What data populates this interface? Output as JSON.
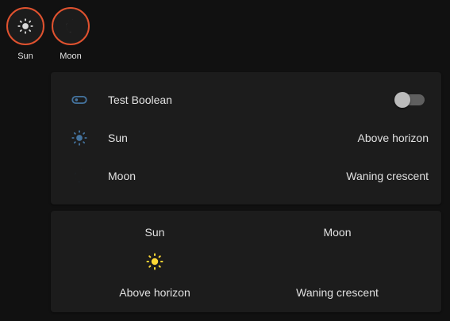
{
  "badges": [
    {
      "label": "Sun",
      "icon": "sun-icon"
    },
    {
      "label": "Moon",
      "icon": "moon-icon"
    }
  ],
  "entities": [
    {
      "name": "Test Boolean",
      "icon": "toggle-icon",
      "state": "off"
    },
    {
      "name": "Sun",
      "icon": "sun-icon",
      "state": "Above horizon"
    },
    {
      "name": "Moon",
      "icon": "moon-icon",
      "state": "Waning crescent"
    }
  ],
  "glance": [
    {
      "name": "Sun",
      "icon": "sun-icon",
      "state": "Above horizon"
    },
    {
      "name": "Moon",
      "icon": "moon-icon",
      "state": "Waning crescent"
    }
  ],
  "colors": {
    "background": "#111111",
    "card": "#1c1c1c",
    "badge_border": "#e0522f",
    "entity_icon": "#44739e",
    "sun_active": "#fdd835",
    "text": "#e1e1e1"
  }
}
